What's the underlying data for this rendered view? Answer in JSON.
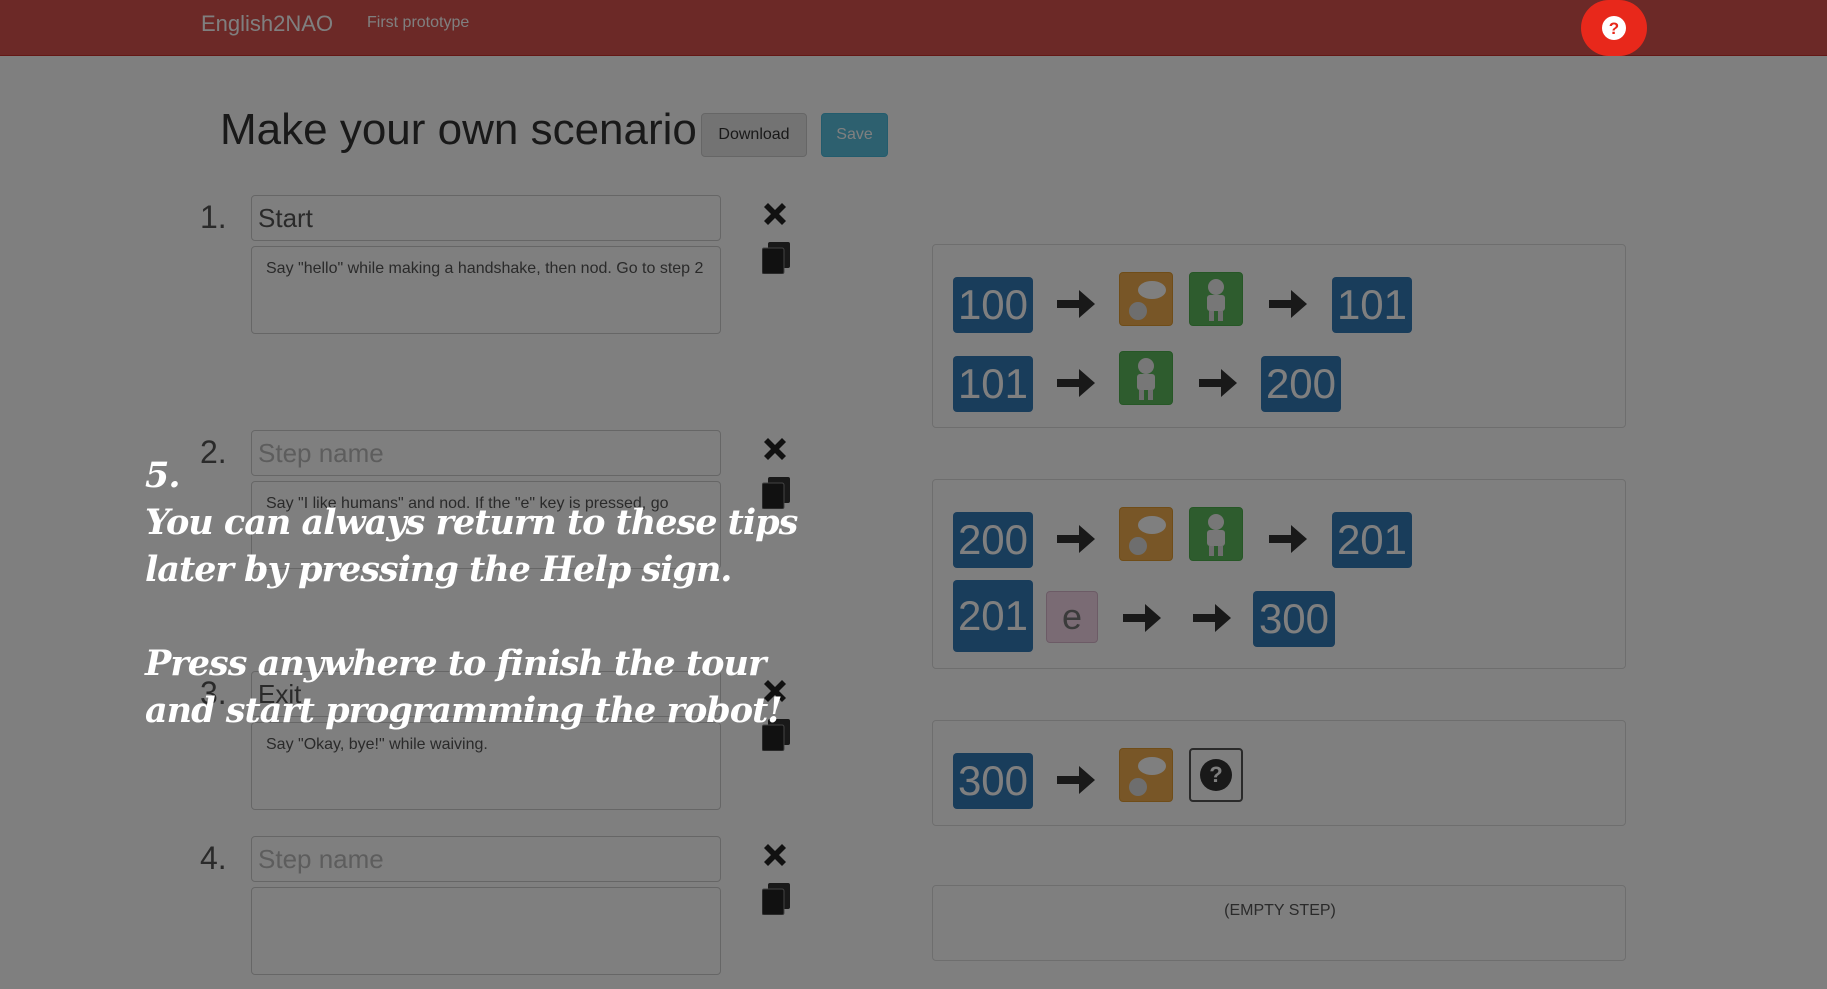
{
  "navbar": {
    "brand": "English2NAO",
    "link": "First prototype"
  },
  "header": {
    "title": "Make your own scenario",
    "download_label": "Download",
    "save_label": "Save"
  },
  "steps": [
    {
      "number": "1.",
      "name": "Start",
      "name_placeholder": "Step name",
      "description": "Say \"hello\" while making a handshake, then nod. Go to step 2"
    },
    {
      "number": "2.",
      "name": "",
      "name_placeholder": "Step name",
      "description": "Say \"I like humans\" and nod. If the \"e\" key is pressed, go"
    },
    {
      "number": "3.",
      "name": "Exit",
      "name_placeholder": "Step name",
      "description": "Say \"Okay, bye!\" while waiving."
    },
    {
      "number": "4.",
      "name": "",
      "name_placeholder": "Step name",
      "description": ""
    }
  ],
  "rules": {
    "step1": [
      {
        "from": "100",
        "to": "101",
        "actions": [
          "speech-icon",
          "robot-icon"
        ]
      },
      {
        "from": "101",
        "to": "200",
        "actions": [
          "robot-icon"
        ]
      }
    ],
    "step2": [
      {
        "from": "200",
        "to": "201",
        "actions": [
          "speech-icon",
          "robot-icon"
        ]
      },
      {
        "from": "201",
        "to": "300",
        "trigger_key": "e",
        "actions": []
      }
    ],
    "step3": [
      {
        "from": "300",
        "actions": [
          "speech-icon",
          "question-icon"
        ]
      }
    ],
    "step4_empty": "(EMPTY STEP)"
  },
  "tour": {
    "step": "5.",
    "line1": "You can always return to these tips later by pressing the Help sign.",
    "line2": "Press anywhere to finish the tour and start programming the robot!"
  },
  "colors": {
    "navbar": "#d9534f",
    "badge": "#337ab7",
    "speech_tile": "#f0ad4e",
    "robot_tile": "#5cb85c",
    "help_button": "#e8281b"
  }
}
